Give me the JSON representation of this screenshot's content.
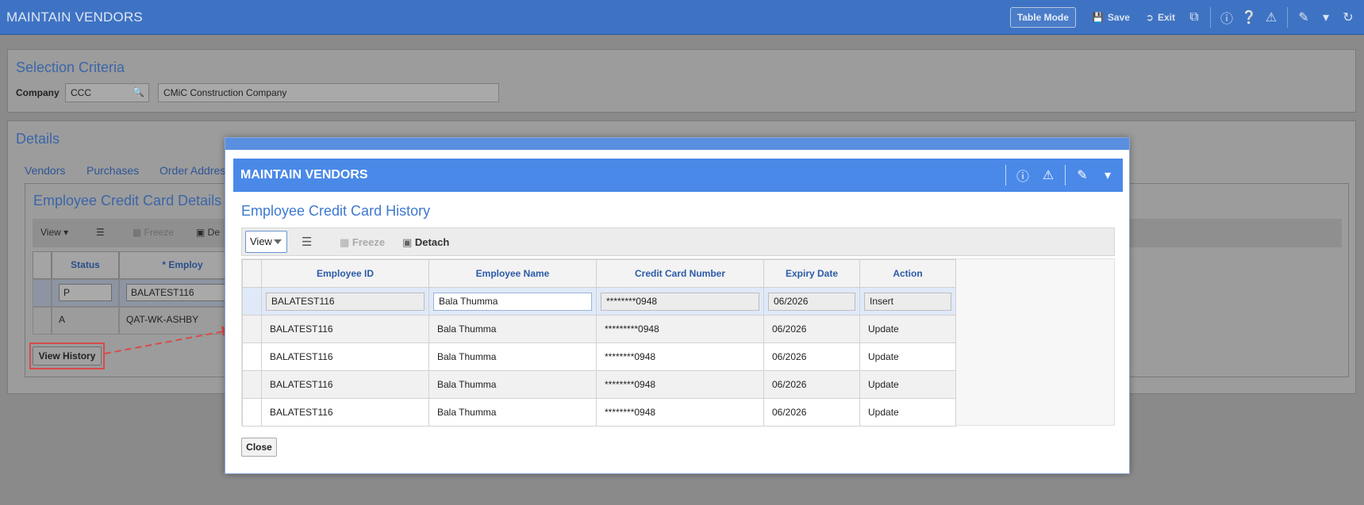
{
  "app": {
    "title": "MAINTAIN VENDORS",
    "table_mode": "Table Mode",
    "save": "Save",
    "exit": "Exit"
  },
  "selection": {
    "title": "Selection Criteria",
    "company_label": "Company",
    "company_code": "CCC",
    "company_name": "CMiC Construction Company"
  },
  "details": {
    "title": "Details",
    "tabs": [
      "Vendors",
      "Purchases",
      "Order Addres"
    ],
    "sub_title": "Employee Credit Card Details",
    "toolbar": {
      "view": "View",
      "freeze": "Freeze",
      "detach": "De"
    },
    "columns": [
      "Status",
      "* Employ"
    ],
    "rows": [
      {
        "status": "P",
        "employee": "BALATEST116"
      },
      {
        "status": "A",
        "employee": "QAT-WK-ASHBY"
      }
    ],
    "view_history": "View History"
  },
  "modal": {
    "title": "MAINTAIN VENDORS",
    "subtitle": "Employee Credit Card History",
    "toolbar": {
      "view": "View",
      "freeze": "Freeze",
      "detach": "Detach"
    },
    "columns": [
      "Employee ID",
      "Employee Name",
      "Credit Card Number",
      "Expiry Date",
      "Action"
    ],
    "rows": [
      {
        "id": "BALATEST116",
        "name": "Bala Thumma",
        "card": "********0948",
        "expiry": "06/2026",
        "action": "Insert"
      },
      {
        "id": "BALATEST116",
        "name": "Bala Thumma",
        "card": "*********0948",
        "expiry": "06/2026",
        "action": "Update"
      },
      {
        "id": "BALATEST116",
        "name": "Bala Thumma",
        "card": "********0948",
        "expiry": "06/2026",
        "action": "Update"
      },
      {
        "id": "BALATEST116",
        "name": "Bala Thumma",
        "card": "********0948",
        "expiry": "06/2026",
        "action": "Update"
      },
      {
        "id": "BALATEST116",
        "name": "Bala Thumma",
        "card": "********0948",
        "expiry": "06/2026",
        "action": "Update"
      }
    ],
    "close": "Close"
  }
}
